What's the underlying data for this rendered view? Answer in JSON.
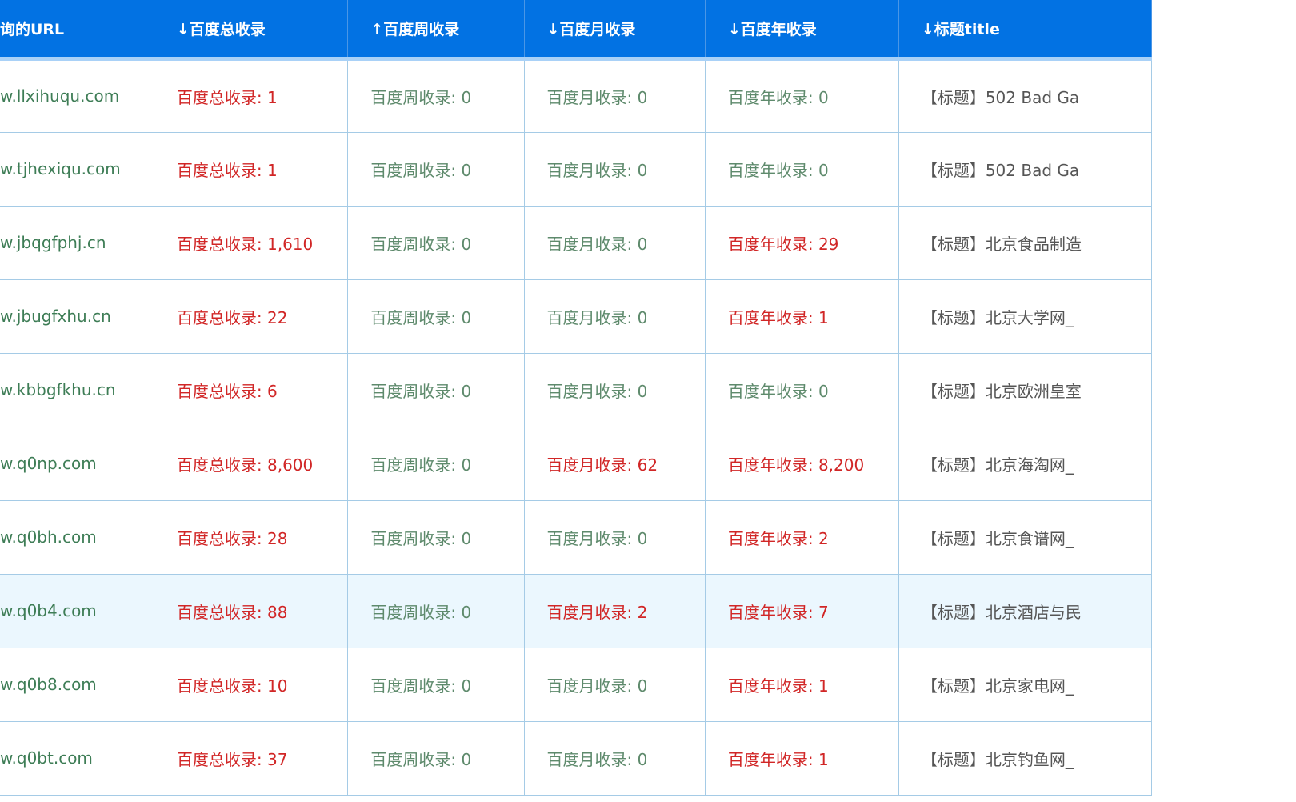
{
  "colors": {
    "header_bg": "#0272e3",
    "header_text": "#ffffff",
    "url_text": "#3e7d56",
    "zero_value": "#5e8a6c",
    "nonzero_value": "#d12626",
    "title_text": "#555555",
    "row_hover_bg": "#ebf7fe",
    "grid_line": "#a5cbe6"
  },
  "table": {
    "headers": {
      "url": "询的URL",
      "total": "↓百度总收录",
      "week": "↑百度周收录",
      "month": "↓百度月收录",
      "year": "↓百度年收录",
      "title": "↓标题title"
    },
    "rows": [
      {
        "url": "w.llxihuqu.com",
        "total": "百度总收录: 1",
        "total_hit": true,
        "week": "百度周收录: 0",
        "week_hit": false,
        "month": "百度月收录: 0",
        "month_hit": false,
        "year": "百度年收录: 0",
        "year_hit": false,
        "title": "【标题】502 Bad Ga"
      },
      {
        "url": "w.tjhexiqu.com",
        "total": "百度总收录: 1",
        "total_hit": true,
        "week": "百度周收录: 0",
        "week_hit": false,
        "month": "百度月收录: 0",
        "month_hit": false,
        "year": "百度年收录: 0",
        "year_hit": false,
        "title": "【标题】502 Bad Ga"
      },
      {
        "url": "w.jbqgfphj.cn",
        "total": "百度总收录: 1,610",
        "total_hit": true,
        "week": "百度周收录: 0",
        "week_hit": false,
        "month": "百度月收录: 0",
        "month_hit": false,
        "year": "百度年收录: 29",
        "year_hit": true,
        "title": "【标题】北京食品制造"
      },
      {
        "url": "w.jbugfxhu.cn",
        "total": "百度总收录: 22",
        "total_hit": true,
        "week": "百度周收录: 0",
        "week_hit": false,
        "month": "百度月收录: 0",
        "month_hit": false,
        "year": "百度年收录: 1",
        "year_hit": true,
        "title": "【标题】北京大学网_"
      },
      {
        "url": "w.kbbgfkhu.cn",
        "total": "百度总收录: 6",
        "total_hit": true,
        "week": "百度周收录: 0",
        "week_hit": false,
        "month": "百度月收录: 0",
        "month_hit": false,
        "year": "百度年收录: 0",
        "year_hit": false,
        "title": "【标题】北京欧洲皇室"
      },
      {
        "url": "w.q0np.com",
        "total": "百度总收录: 8,600",
        "total_hit": true,
        "week": "百度周收录: 0",
        "week_hit": false,
        "month": "百度月收录: 62",
        "month_hit": true,
        "year": "百度年收录: 8,200",
        "year_hit": true,
        "title": "【标题】北京海淘网_"
      },
      {
        "url": "w.q0bh.com",
        "total": "百度总收录: 28",
        "total_hit": true,
        "week": "百度周收录: 0",
        "week_hit": false,
        "month": "百度月收录: 0",
        "month_hit": false,
        "year": "百度年收录: 2",
        "year_hit": true,
        "title": "【标题】北京食谱网_"
      },
      {
        "url": "w.q0b4.com",
        "total": "百度总收录: 88",
        "total_hit": true,
        "week": "百度周收录: 0",
        "week_hit": false,
        "month": "百度月收录: 2",
        "month_hit": true,
        "year": "百度年收录: 7",
        "year_hit": true,
        "title": "【标题】北京酒店与民",
        "hover": true
      },
      {
        "url": "w.q0b8.com",
        "total": "百度总收录: 10",
        "total_hit": true,
        "week": "百度周收录: 0",
        "week_hit": false,
        "month": "百度月收录: 0",
        "month_hit": false,
        "year": "百度年收录: 1",
        "year_hit": true,
        "title": "【标题】北京家电网_"
      },
      {
        "url": "w.q0bt.com",
        "total": "百度总收录: 37",
        "total_hit": true,
        "week": "百度周收录: 0",
        "week_hit": false,
        "month": "百度月收录: 0",
        "month_hit": false,
        "year": "百度年收录: 1",
        "year_hit": true,
        "title": "【标题】北京钓鱼网_"
      }
    ]
  }
}
